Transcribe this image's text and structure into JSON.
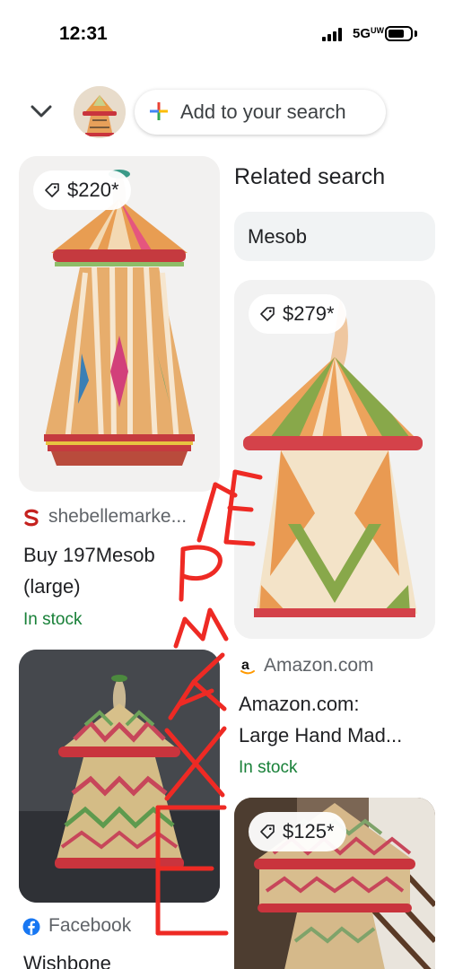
{
  "status_bar": {
    "time": "12:31",
    "network": "5G",
    "network_suffix": "UW"
  },
  "search_bar": {
    "collapse_icon": "chevron-down-icon",
    "add_label": "Add to your search",
    "plus_icon": "google-plus-icon"
  },
  "results": [
    {
      "price": "$220*",
      "source": "shebellemarke...",
      "source_icon": "shebelle-logo-icon",
      "title_lines": [
        "Buy 197Mesob",
        "(large)"
      ],
      "stock": "In stock"
    },
    {
      "price": "$279*",
      "source": "Amazon.com",
      "source_icon": "amazon-logo-icon",
      "title_lines": [
        "Amazon.com:",
        "Large Hand Mad..."
      ],
      "stock": "In stock"
    },
    {
      "source": "Facebook",
      "source_icon": "facebook-logo-icon",
      "title_lines": [
        "Wishbone"
      ]
    },
    {
      "price": "$125*"
    }
  ],
  "related_search": {
    "heading": "Related search",
    "chip": "Mesob"
  },
  "watermark": {
    "text": "EXAMPLE"
  },
  "colors": {
    "in_stock_green": "#188038",
    "watermark_red": "#ee2a24",
    "chip_bg": "#f1f3f4"
  }
}
